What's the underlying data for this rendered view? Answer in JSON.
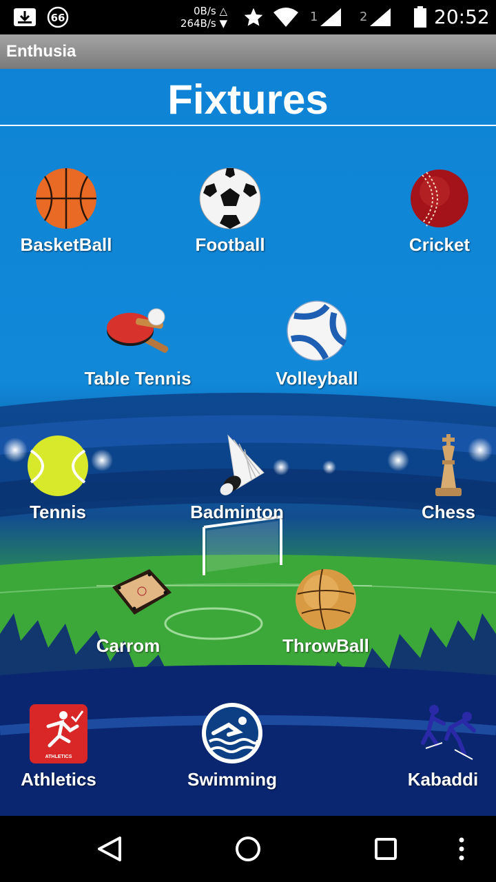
{
  "status_bar": {
    "net_up": "0B/s △",
    "net_down": "264B/s ▼",
    "notification_count": "66",
    "sim1": "1",
    "sim2": "2",
    "time": "20:52"
  },
  "app_bar": {
    "title": "Enthusia"
  },
  "page": {
    "title": "Fixtures"
  },
  "sports": [
    {
      "label": "BasketBall",
      "icon": "basketball-icon"
    },
    {
      "label": "Football",
      "icon": "football-icon"
    },
    {
      "label": "Cricket",
      "icon": "cricket-ball-icon"
    },
    {
      "label": "Table Tennis",
      "icon": "table-tennis-icon"
    },
    {
      "label": "Volleyball",
      "icon": "volleyball-icon"
    },
    {
      "label": "Tennis",
      "icon": "tennis-ball-icon"
    },
    {
      "label": "Badminton",
      "icon": "shuttlecock-icon"
    },
    {
      "label": "Chess",
      "icon": "chess-king-icon"
    },
    {
      "label": "Carrom",
      "icon": "carrom-board-icon"
    },
    {
      "label": "ThrowBall",
      "icon": "throwball-icon"
    },
    {
      "label": "Athletics",
      "icon": "athletics-icon"
    },
    {
      "label": "Swimming",
      "icon": "swimming-icon"
    },
    {
      "label": "Kabaddi",
      "icon": "kabaddi-icon"
    }
  ],
  "nav_bar": {
    "back": "back-icon",
    "home": "home-icon",
    "recents": "recents-icon",
    "menu": "overflow-menu-icon"
  },
  "colors": {
    "sky_blue": "#0f84d6",
    "app_bar_gray": "#8a8a8a",
    "field_green": "#3fae3a"
  }
}
